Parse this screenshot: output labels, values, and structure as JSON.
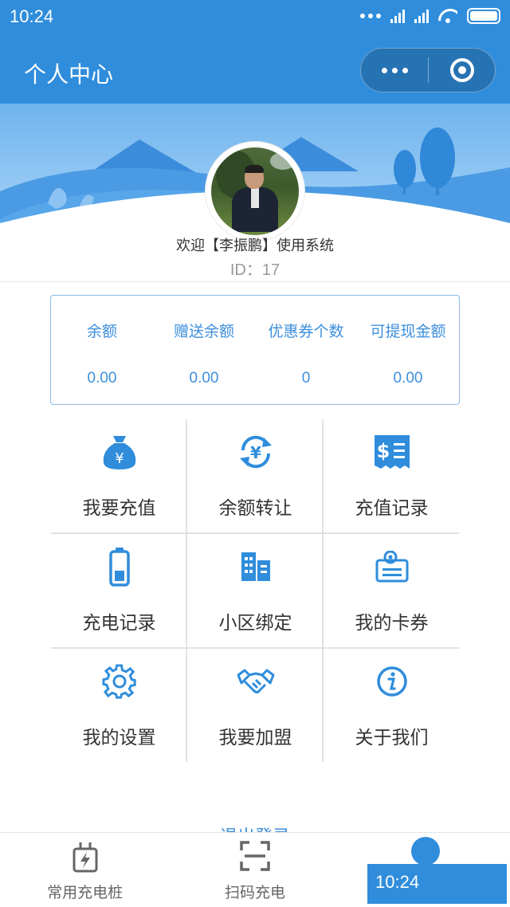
{
  "status_bar": {
    "time": "10:24"
  },
  "header": {
    "title": "个人中心"
  },
  "profile": {
    "welcome": "欢迎【李振鹏】使用系统",
    "id_text": "ID：17"
  },
  "stats": [
    {
      "label": "余额",
      "value": "0.00"
    },
    {
      "label": "赠送余额",
      "value": "0.00"
    },
    {
      "label": "优惠券个数",
      "value": "0"
    },
    {
      "label": "可提现金额",
      "value": "0.00"
    }
  ],
  "menu": [
    {
      "label": "我要充值",
      "icon": "money-bag-icon"
    },
    {
      "label": "余额转让",
      "icon": "yen-transfer-icon"
    },
    {
      "label": "充值记录",
      "icon": "receipt-icon"
    },
    {
      "label": "充电记录",
      "icon": "battery-icon"
    },
    {
      "label": "小区绑定",
      "icon": "building-icon"
    },
    {
      "label": "我的卡券",
      "icon": "coupon-card-icon"
    },
    {
      "label": "我的设置",
      "icon": "gear-icon"
    },
    {
      "label": "我要加盟",
      "icon": "handshake-icon"
    },
    {
      "label": "关于我们",
      "icon": "info-icon"
    }
  ],
  "logout_partial": "退出登录",
  "tabs": [
    {
      "label": "常用充电桩",
      "icon": "charging-station-icon"
    },
    {
      "label": "扫码充电",
      "icon": "scan-icon"
    },
    {
      "label": "",
      "icon": "person-icon"
    }
  ],
  "toast": {
    "text": "10:24"
  },
  "colors": {
    "primary": "#2f8ddc",
    "accent_text": "#3d8fdb"
  }
}
